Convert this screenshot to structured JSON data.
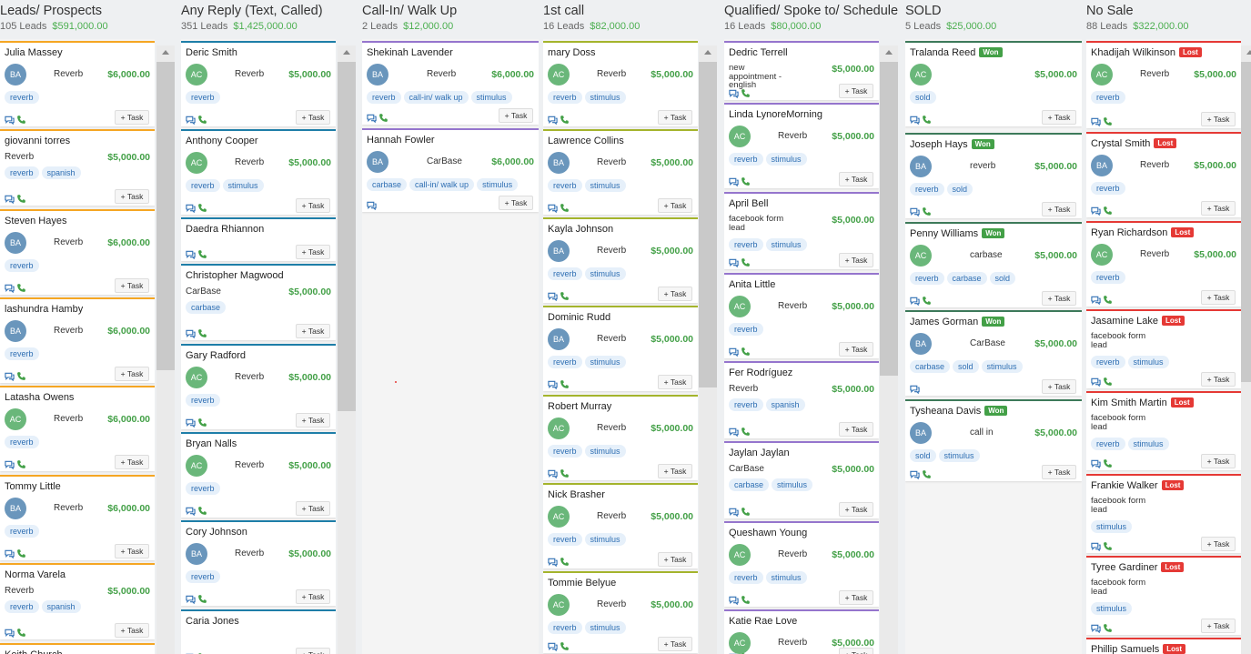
{
  "colors": {
    "accent_green": "#43a047",
    "won": "#43a047",
    "lost": "#e53935",
    "avatar_BA": "#6a96bc",
    "avatar_AC": "#6ab77a",
    "tag_text": "#2f6fb3",
    "tag_bg": "#e6f0fa"
  },
  "task_label": "+ Task",
  "columns": [
    {
      "title": "Leads/ Prospects",
      "count": "105 Leads",
      "total": "$591,000.00",
      "accent": "#f5a623",
      "scroll_thumb": [
        0.0,
        0.52
      ],
      "cards": [
        {
          "name": "Julia Massey",
          "avatar": "BA",
          "source": "Reverb",
          "amount": "$6,000.00",
          "tags": [
            "reverb"
          ]
        },
        {
          "name": "giovanni torres",
          "source": "Reverb",
          "amount": "$5,000.00",
          "tags": [
            "reverb",
            "spanish"
          ]
        },
        {
          "name": "Steven Hayes",
          "avatar": "BA",
          "source": "Reverb",
          "amount": "$6,000.00",
          "tags": [
            "reverb"
          ]
        },
        {
          "name": "lashundra Hamby",
          "avatar": "BA",
          "source": "Reverb",
          "amount": "$6,000.00",
          "tags": [
            "reverb"
          ]
        },
        {
          "name": "Latasha Owens",
          "avatar": "AC",
          "source": "Reverb",
          "amount": "$6,000.00",
          "tags": [
            "reverb"
          ]
        },
        {
          "name": "Tommy Little",
          "avatar": "BA",
          "source": "Reverb",
          "amount": "$6,000.00",
          "tags": [
            "reverb"
          ]
        },
        {
          "name": "Norma Varela",
          "source": "Reverb",
          "amount": "$5,000.00",
          "tags": [
            "reverb",
            "spanish"
          ]
        },
        {
          "name": "Keith Church"
        }
      ]
    },
    {
      "title": "Any Reply (Text, Called)",
      "count": "351 Leads",
      "total": "$1,425,000.00",
      "accent": "#1e7ea8",
      "scroll_thumb": [
        0.0,
        0.59
      ],
      "cards": [
        {
          "name": "Deric Smith",
          "avatar": "AC",
          "source": "Reverb",
          "amount": "$5,000.00",
          "tags": [
            "reverb"
          ]
        },
        {
          "name": "Anthony Cooper",
          "avatar": "AC",
          "source": "Reverb",
          "amount": "$5,000.00",
          "tags": [
            "reverb",
            "stimulus"
          ]
        },
        {
          "name": "Daedra Rhiannon"
        },
        {
          "name": "Christopher Magwood",
          "source": "CarBase",
          "amount": "$5,000.00",
          "tags": [
            "carbase"
          ]
        },
        {
          "name": "Gary Radford",
          "avatar": "AC",
          "source": "Reverb",
          "amount": "$5,000.00",
          "tags": [
            "reverb"
          ]
        },
        {
          "name": "Bryan Nalls",
          "avatar": "AC",
          "source": "Reverb",
          "amount": "$5,000.00",
          "tags": [
            "reverb"
          ]
        },
        {
          "name": "Cory Johnson",
          "avatar": "BA",
          "source": "Reverb",
          "amount": "$5,000.00",
          "tags": [
            "reverb"
          ]
        },
        {
          "name": "Caria Jones"
        }
      ]
    },
    {
      "title": "Call-In/ Walk Up",
      "count": "2 Leads",
      "total": "$12,000.00",
      "accent": "#9575cd",
      "cards": [
        {
          "name": "Shekinah Lavender",
          "avatar": "BA",
          "source": "Reverb",
          "amount": "$6,000.00",
          "tags": [
            "reverb",
            "call-in/ walk up",
            "stimulus"
          ]
        },
        {
          "name": "Hannah Fowler",
          "avatar": "BA",
          "source": "CarBase",
          "amount": "$6,000.00",
          "tags": [
            "carbase",
            "call-in/ walk up",
            "stimulus"
          ],
          "chat_only": true
        }
      ]
    },
    {
      "title": "1st call",
      "count": "16 Leads",
      "total": "$82,000.00",
      "accent": "#a4b42c",
      "scroll_thumb": [
        0.0,
        0.55
      ],
      "cards": [
        {
          "name": "mary Doss",
          "avatar": "AC",
          "source": "Reverb",
          "amount": "$5,000.00",
          "tags": [
            "reverb",
            "stimulus"
          ]
        },
        {
          "name": "Lawrence Collins",
          "avatar": "BA",
          "source": "Reverb",
          "amount": "$5,000.00",
          "tags": [
            "reverb",
            "stimulus"
          ]
        },
        {
          "name": "Kayla Johnson",
          "avatar": "BA",
          "source": "Reverb",
          "amount": "$5,000.00",
          "tags": [
            "reverb",
            "stimulus"
          ]
        },
        {
          "name": "Dominic Rudd",
          "avatar": "BA",
          "source": "Reverb",
          "amount": "$5,000.00",
          "tags": [
            "reverb",
            "stimulus"
          ]
        },
        {
          "name": "Robert Murray",
          "avatar": "AC",
          "source": "Reverb",
          "amount": "$5,000.00",
          "tags": [
            "reverb",
            "stimulus"
          ]
        },
        {
          "name": "Nick Brasher",
          "avatar": "AC",
          "source": "Reverb",
          "amount": "$5,000.00",
          "tags": [
            "reverb",
            "stimulus"
          ]
        },
        {
          "name": "Tommie Belyue",
          "avatar": "AC",
          "source": "Reverb",
          "amount": "$5,000.00",
          "tags": [
            "reverb",
            "stimulus"
          ]
        }
      ]
    },
    {
      "title": "Qualified/ Spoke to/ Schedule",
      "count": "16 Leads",
      "total": "$80,000.00",
      "accent": "#9575cd",
      "scroll_thumb": [
        0.0,
        0.53
      ],
      "cards": [
        {
          "name": "Dedric Terrell",
          "source": "new appointment - english",
          "amount": "$5,000.00"
        },
        {
          "name": "Linda LynoreMorning",
          "avatar": "AC",
          "source": "Reverb",
          "amount": "$5,000.00",
          "tags": [
            "reverb",
            "stimulus"
          ]
        },
        {
          "name": "April Bell",
          "source": "facebook form lead",
          "amount": "$5,000.00",
          "tags": [
            "reverb",
            "stimulus"
          ]
        },
        {
          "name": "Anita Little",
          "avatar": "AC",
          "source": "Reverb",
          "amount": "$5,000.00",
          "tags": [
            "reverb"
          ]
        },
        {
          "name": "Fer Rodríguez",
          "source": "Reverb",
          "amount": "$5,000.00",
          "tags": [
            "reverb",
            "spanish"
          ]
        },
        {
          "name": "Jaylan Jaylan",
          "source": "CarBase",
          "amount": "$5,000.00",
          "tags": [
            "carbase",
            "stimulus"
          ]
        },
        {
          "name": "Queshawn Young",
          "avatar": "AC",
          "source": "Reverb",
          "amount": "$5,000.00",
          "tags": [
            "reverb",
            "stimulus"
          ]
        },
        {
          "name": "Katie Rae Love",
          "avatar": "AC",
          "source": "Reverb",
          "amount": "$5,000.00"
        }
      ]
    },
    {
      "title": "SOLD",
      "count": "5 Leads",
      "total": "$25,000.00",
      "accent": "#3d7a5a",
      "cards": [
        {
          "name": "Tralanda Reed",
          "status": "Won",
          "avatar": "AC",
          "amount": "$5,000.00",
          "tags": [
            "sold"
          ]
        },
        {
          "name": "Joseph Hays",
          "status": "Won",
          "avatar": "BA",
          "source": "reverb",
          "amount": "$5,000.00",
          "tags": [
            "reverb",
            "sold"
          ]
        },
        {
          "name": "Penny Williams",
          "status": "Won",
          "avatar": "AC",
          "source": "carbase",
          "amount": "$5,000.00",
          "tags": [
            "reverb",
            "carbase",
            "sold"
          ]
        },
        {
          "name": "James Gorman",
          "status": "Won",
          "avatar": "BA",
          "source": "CarBase",
          "amount": "$5,000.00",
          "tags": [
            "carbase",
            "sold",
            "stimulus"
          ],
          "chat_only": true
        },
        {
          "name": "Tysheana Davis",
          "status": "Won",
          "avatar": "BA",
          "source": "call in",
          "amount": "$5,000.00",
          "tags": [
            "sold",
            "stimulus"
          ]
        }
      ]
    },
    {
      "title": "No Sale",
      "count": "88 Leads",
      "total": "$322,000.00",
      "accent": "#e53935",
      "scroll_thumb": [
        0.0,
        0.54
      ],
      "cards": [
        {
          "name": "Khadijah Wilkinson",
          "status": "Lost",
          "avatar": "AC",
          "source": "Reverb",
          "amount": "$5,000.00",
          "tags": [
            "reverb"
          ]
        },
        {
          "name": "Crystal Smith",
          "status": "Lost",
          "avatar": "BA",
          "source": "Reverb",
          "amount": "$5,000.00",
          "tags": [
            "reverb"
          ]
        },
        {
          "name": "Ryan Richardson",
          "status": "Lost",
          "avatar": "AC",
          "source": "Reverb",
          "amount": "$5,000.00",
          "tags": [
            "reverb"
          ]
        },
        {
          "name": "Jasamine Lake",
          "status": "Lost",
          "source": "facebook form lead",
          "tags": [
            "reverb",
            "stimulus"
          ]
        },
        {
          "name": "Kim Smith Martin",
          "status": "Lost",
          "source": "facebook form lead",
          "tags": [
            "reverb",
            "stimulus"
          ]
        },
        {
          "name": "Frankie Walker",
          "status": "Lost",
          "source": "facebook form lead",
          "tags": [
            "stimulus"
          ]
        },
        {
          "name": "Tyree Gardiner",
          "status": "Lost",
          "source": "facebook form lead",
          "tags": [
            "stimulus"
          ]
        },
        {
          "name": "Phillip Samuels",
          "status": "Lost"
        }
      ]
    }
  ]
}
